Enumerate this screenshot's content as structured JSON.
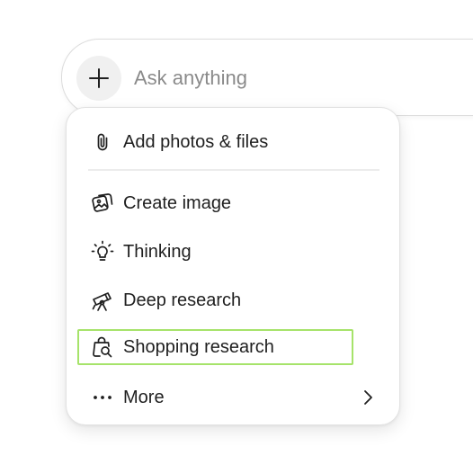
{
  "composer": {
    "placeholder": "Ask anything",
    "plus_icon": "plus-icon"
  },
  "menu": {
    "items": [
      {
        "label": "Add photos & files",
        "icon": "paperclip-icon"
      },
      {
        "label": "Create image",
        "icon": "image-icon"
      },
      {
        "label": "Thinking",
        "icon": "lightbulb-icon"
      },
      {
        "label": "Deep research",
        "icon": "telescope-icon"
      },
      {
        "label": "Shopping research",
        "icon": "shopping-bag-search-icon",
        "highlighted": true
      },
      {
        "label": "More",
        "icon": "more-dots-icon",
        "submenu_icon": "chevron-right-icon"
      }
    ]
  },
  "colors": {
    "highlight_border": "#a6e36a",
    "text": "#1f1f1f",
    "placeholder": "#8a8a8a",
    "plus_button_bg": "#f0f0f0"
  }
}
